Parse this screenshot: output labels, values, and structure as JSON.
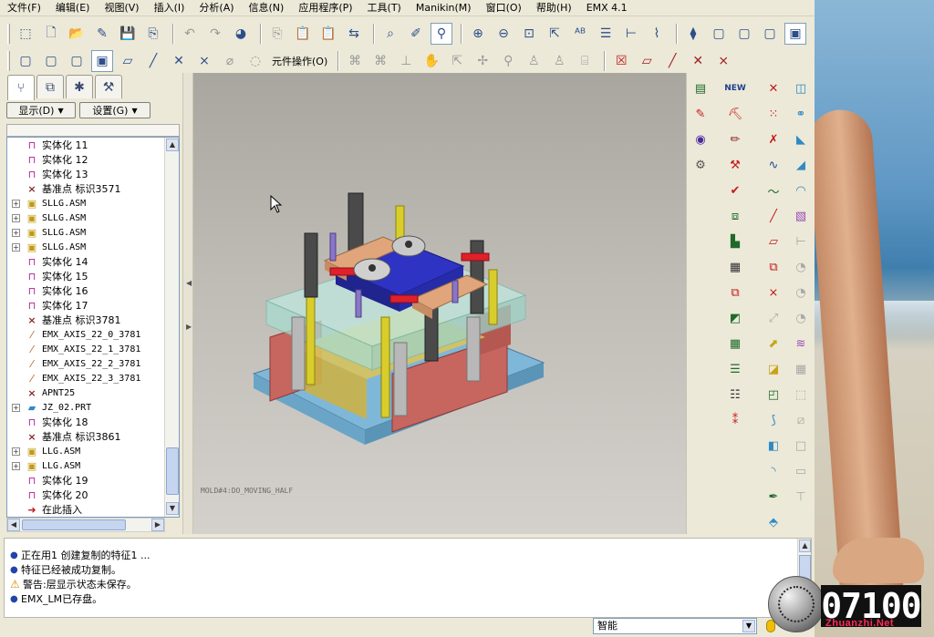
{
  "menu": [
    "文件(F)",
    "编辑(E)",
    "视图(V)",
    "插入(I)",
    "分析(A)",
    "信息(N)",
    "应用程序(P)",
    "工具(T)",
    "Manikin(M)",
    "窗口(O)",
    "帮助(H)",
    "EMX 4.1"
  ],
  "toolbar": {
    "top_icons": [
      "select-icon",
      "new-icon",
      "open-icon",
      "edit-icon",
      "save-icon",
      "save-copy-icon",
      "undo-icon",
      "redo-icon",
      "color-icon",
      "copy-icon",
      "paste-icon",
      "paste-special-icon",
      "regenerate-icon",
      "search-icon",
      "sketch-icon",
      "datum-display-icon",
      "zoom-in-icon",
      "zoom-out-icon",
      "refit-icon",
      "orient-icon",
      "rename-icon",
      "layer-icon",
      "measure-icon",
      "curve-icon",
      "model-icon",
      "wireframe-icon",
      "hidden-line-icon",
      "no-hidden-icon",
      "shading-icon"
    ],
    "component_operation": "元件操作(O)"
  },
  "panel": {
    "tabs": [
      "model-tree-tab",
      "layer-tree-tab",
      "favorites-tab",
      "connections-tab"
    ],
    "show_label": "显示(D)",
    "settings_label": "设置(G)"
  },
  "tree": [
    {
      "kind": "feature",
      "label": "实体化 11",
      "toggle": false
    },
    {
      "kind": "feature",
      "label": "实体化 12",
      "toggle": false
    },
    {
      "kind": "feature",
      "label": "实体化 13",
      "toggle": false
    },
    {
      "kind": "datum",
      "label": "基准点 标识3571",
      "toggle": false
    },
    {
      "kind": "asm",
      "label": "SLLG.ASM",
      "toggle": true
    },
    {
      "kind": "asm",
      "label": "SLLG.ASM",
      "toggle": true
    },
    {
      "kind": "asm",
      "label": "SLLG.ASM",
      "toggle": true
    },
    {
      "kind": "asm",
      "label": "SLLG.ASM",
      "toggle": true
    },
    {
      "kind": "feature",
      "label": "实体化 14",
      "toggle": false
    },
    {
      "kind": "feature",
      "label": "实体化 15",
      "toggle": false
    },
    {
      "kind": "feature",
      "label": "实体化 16",
      "toggle": false
    },
    {
      "kind": "feature",
      "label": "实体化 17",
      "toggle": false
    },
    {
      "kind": "datum",
      "label": "基准点 标识3781",
      "toggle": false
    },
    {
      "kind": "axis",
      "label": "EMX_AXIS_22_0_3781",
      "toggle": false
    },
    {
      "kind": "axis",
      "label": "EMX_AXIS_22_1_3781",
      "toggle": false
    },
    {
      "kind": "axis",
      "label": "EMX_AXIS_22_2_3781",
      "toggle": false
    },
    {
      "kind": "axis",
      "label": "EMX_AXIS_22_3_3781",
      "toggle": false
    },
    {
      "kind": "datum",
      "label": "APNT25",
      "toggle": false
    },
    {
      "kind": "part",
      "label": "JZ_02.PRT",
      "toggle": true
    },
    {
      "kind": "feature",
      "label": "实体化 18",
      "toggle": false
    },
    {
      "kind": "datum",
      "label": "基准点 标识3861",
      "toggle": false
    },
    {
      "kind": "asm",
      "label": "LLG.ASM",
      "toggle": true
    },
    {
      "kind": "asm",
      "label": "LLG.ASM",
      "toggle": true
    },
    {
      "kind": "feature",
      "label": "实体化 19",
      "toggle": false
    },
    {
      "kind": "feature",
      "label": "实体化 20",
      "toggle": false
    },
    {
      "kind": "insert",
      "label": "在此插入",
      "toggle": false
    }
  ],
  "graphics": {
    "model_label": "MOLD#4:DO_MOVING_HALF"
  },
  "messages": [
    {
      "type": "info",
      "text": "正在用1 创建复制的特征1 ..."
    },
    {
      "type": "info",
      "text": "特征已经被成功复制。"
    },
    {
      "type": "warning",
      "text": "警告:层显示状态未保存。"
    },
    {
      "type": "info",
      "text": "EMX_LM已存盘。"
    }
  ],
  "status": {
    "filter": "智能"
  },
  "watermark": {
    "number": "07100",
    "site": "Zhuanzhi.Net"
  }
}
